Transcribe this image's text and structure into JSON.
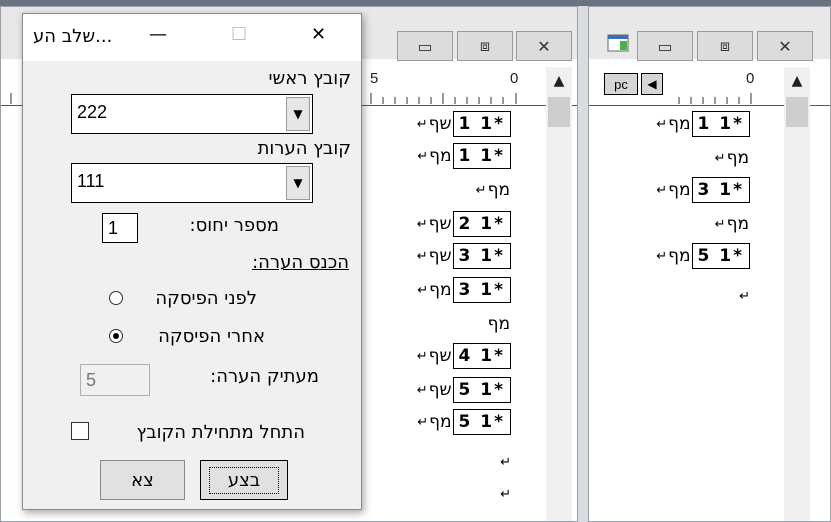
{
  "dialog": {
    "title": "...שלב הע",
    "controls": {
      "minimize": "—",
      "maximize": "☐",
      "close": "✕"
    },
    "main_file_label": "קובץ ראשי",
    "main_file_value": "222",
    "notes_file_label": "קובץ הערות",
    "notes_file_value": "111",
    "ref_number_label": "מספר יחוס:",
    "ref_number_value": "1",
    "insert_note_label": "הכנס הערה:",
    "radio_before": "לפני הפיסקה",
    "radio_after": "אחרי הפיסקה",
    "selected_radio": "after",
    "note_copier_label": "מעתיק הערה:",
    "note_copier_value": "5",
    "start_from_file_begin": "התחל מתחילת הקובץ",
    "execute_button": "בצע",
    "exit_button": "צא"
  },
  "middle_window": {
    "controls": {
      "minimize": "▭",
      "maximize": "⧈",
      "close": "✕"
    },
    "ruler_labels": [
      "5",
      "0"
    ],
    "scroll_up_icon": "▲",
    "rows": [
      {
        "box": "1 1*",
        "heb": "שף",
        "mark": "↵"
      },
      {
        "box": "1 1*",
        "heb": "מף",
        "mark": "↵"
      },
      {
        "box": "",
        "heb": "מף",
        "mark": "↵"
      },
      {
        "box": "2 1*",
        "heb": "שף",
        "mark": "↵"
      },
      {
        "box": "3 1*",
        "heb": "שף",
        "mark": "↵"
      },
      {
        "box": "3 1*",
        "heb": "מף",
        "mark": "↵"
      },
      {
        "box": "",
        "heb": "מף",
        "mark": ""
      },
      {
        "box": "4 1*",
        "heb": "שף",
        "mark": "↵"
      },
      {
        "box": "5 1*",
        "heb": "שף",
        "mark": "↵"
      },
      {
        "box": "5 1*",
        "heb": "מף",
        "mark": "↵"
      },
      {
        "box": "",
        "heb": "",
        "mark": "↵"
      },
      {
        "box": "",
        "heb": "",
        "mark": "↵"
      }
    ]
  },
  "right_window": {
    "controls": {
      "minimize": "▭",
      "maximize": "⧈",
      "close": "✕"
    },
    "pc_label": "pc",
    "left_arrow_icon": "◀",
    "ruler_labels": [
      "0"
    ],
    "scroll_up_icon": "▲",
    "rows": [
      {
        "box": "1 1*",
        "heb": "מף",
        "mark": "↵"
      },
      {
        "box": "",
        "heb": "מף",
        "mark": "↵"
      },
      {
        "box": "3 1*",
        "heb": "מף",
        "mark": "↵"
      },
      {
        "box": "",
        "heb": "מף",
        "mark": "↵"
      },
      {
        "box": "5 1*",
        "heb": "מף",
        "mark": "↵"
      },
      {
        "box": "",
        "heb": "",
        "mark": "↵"
      }
    ]
  }
}
